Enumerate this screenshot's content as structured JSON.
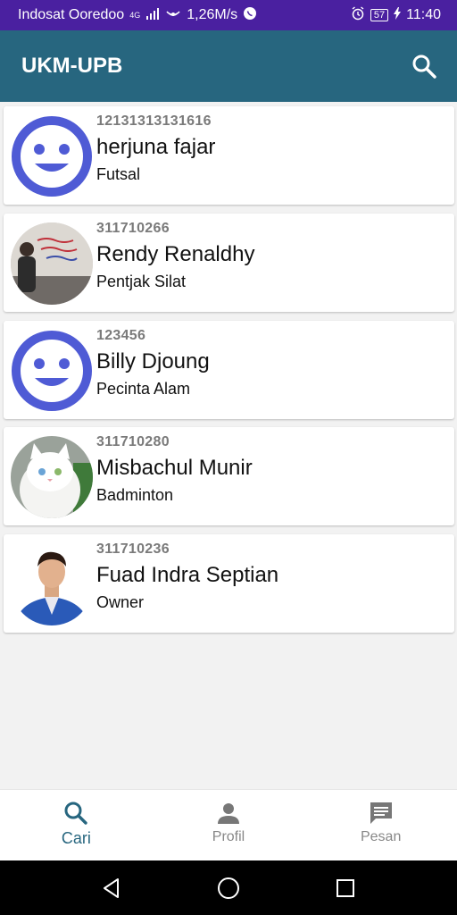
{
  "status_bar": {
    "carrier": "Indosat Ooredoo",
    "network": "4G",
    "speed": "1,26M/s",
    "battery": "57",
    "time": "11:40"
  },
  "app_bar": {
    "title": "UKM-UPB"
  },
  "members": [
    {
      "id": "12131313131616",
      "name": "herjuna fajar",
      "ukm": "Futsal",
      "avatar": "default-face"
    },
    {
      "id": "311710266",
      "name": "Rendy Renaldhy",
      "ukm": "Pentjak Silat",
      "avatar": "photo-wall"
    },
    {
      "id": "123456",
      "name": "Billy Djoung",
      "ukm": "Pecinta Alam",
      "avatar": "default-face"
    },
    {
      "id": "311710280",
      "name": "Misbachul Munir",
      "ukm": "Badminton",
      "avatar": "photo-cat"
    },
    {
      "id": "311710236",
      "name": "Fuad Indra Septian",
      "ukm": "Owner",
      "avatar": "photo-man"
    }
  ],
  "bottom_nav": [
    {
      "label": "Cari",
      "icon": "search-icon",
      "active": true
    },
    {
      "label": "Profil",
      "icon": "person-icon",
      "active": false
    },
    {
      "label": "Pesan",
      "icon": "message-icon",
      "active": false
    }
  ],
  "colors": {
    "status_bar": "#4a20a0",
    "app_bar": "#27667f",
    "accent": "#27667f",
    "default_avatar": "#4f5bd5"
  }
}
